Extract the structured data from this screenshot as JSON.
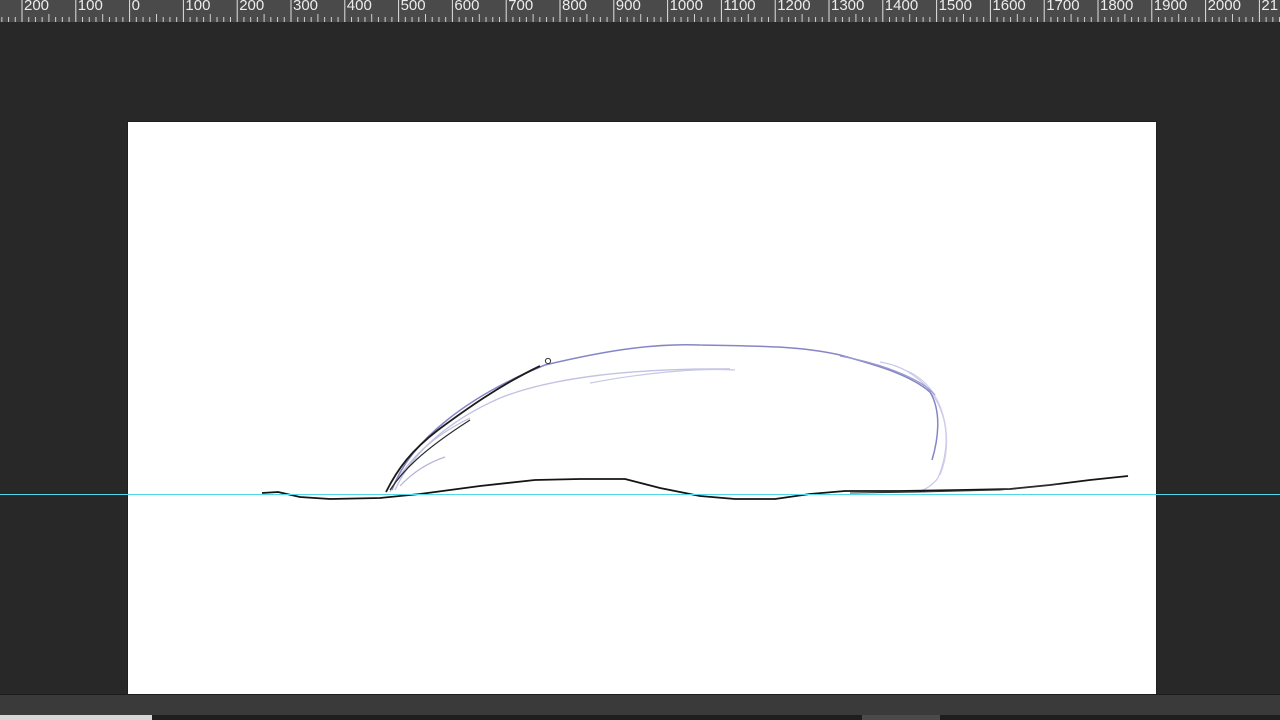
{
  "ruler": {
    "unit_step": 100,
    "labels": [
      "200",
      "100",
      "0",
      "100",
      "200",
      "300",
      "400",
      "500",
      "600",
      "700",
      "800",
      "900",
      "1000",
      "1100",
      "1200",
      "1300",
      "1400",
      "1500",
      "1600",
      "1700",
      "1800",
      "1900",
      "2000",
      "21"
    ]
  },
  "colors": {
    "workspace": "#282828",
    "ruler_bg": "#4a4a4a",
    "ruler_text": "#ececec",
    "canvas": "#ffffff",
    "guide": "#4fd8ea",
    "sketch_dark": "#1a1a1a",
    "sketch_blue": "#7f7fc4",
    "sketch_blue_light": "#b9b9e0"
  },
  "icons": {
    "brush_cursor": "brush-cursor-icon"
  }
}
